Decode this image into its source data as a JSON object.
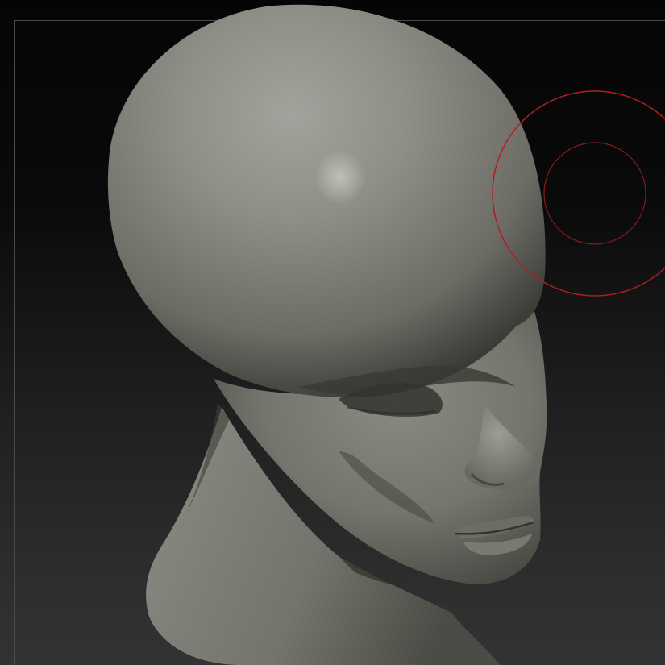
{
  "app": {
    "view": "sculpt-viewport"
  },
  "viewport": {
    "background_top": "#050505",
    "background_bottom": "#333333",
    "frame_color": "#4a4a4a"
  },
  "model": {
    "subject": "head-bust",
    "material_color": "#8a8a82"
  },
  "brush_cursor": {
    "color": "#b01e1e"
  }
}
